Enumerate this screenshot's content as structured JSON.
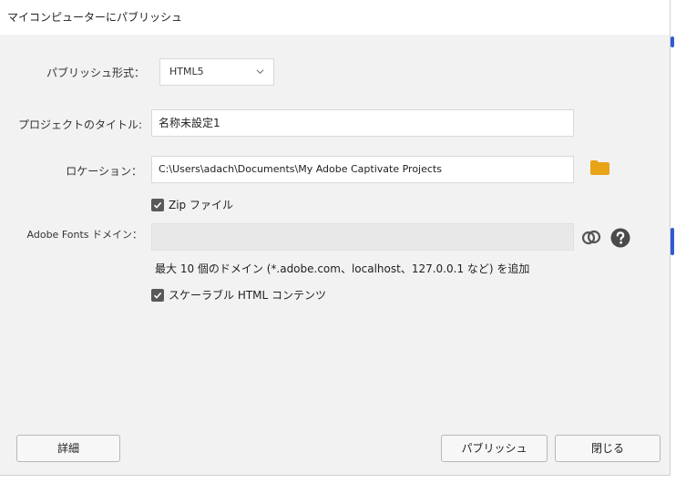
{
  "window": {
    "title": "マイコンピューターにパブリッシュ"
  },
  "form": {
    "publish_format_label": "パブリッシュ形式：",
    "publish_format_value": "HTML5",
    "project_title_label": "プロジェクトのタイトル:",
    "project_title_value": "名称未設定1",
    "location_label": "ロケーション：",
    "location_value": "C:\\Users\\adach\\Documents\\My Adobe Captivate Projects",
    "zip_checkbox_label": "Zip ファイル",
    "zip_checked": true,
    "adobe_fonts_label": "Adobe Fonts ドメイン：",
    "adobe_fonts_value": "",
    "domain_note": "最大 10 個のドメイン (*.adobe.com、localhost、127.0.0.1 など) を追加",
    "scalable_checkbox_label": "スケーラブル HTML コンテンツ",
    "scalable_checked": true
  },
  "buttons": {
    "details": "詳細",
    "publish": "パブリッシュ",
    "close": "閉じる"
  },
  "colors": {
    "dialog_bg": "#f2f2f2",
    "titlebar_bg": "#ffffff",
    "checkbox": "#595959",
    "folder": "#e8a317",
    "edge_accent": "#2f5bd3"
  },
  "icons": [
    "chevron-down-icon",
    "folder-icon",
    "checkmark-icon",
    "creative-cloud-icon",
    "help-icon"
  ]
}
